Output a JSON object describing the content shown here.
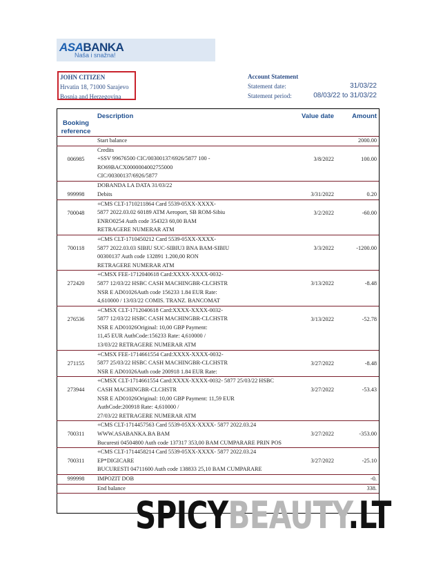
{
  "bank": {
    "logo_asa": "ASA",
    "logo_banka": "BANKA",
    "tagline": "Naša i snažna!"
  },
  "client": {
    "name": "JOHN CITIZEN",
    "address": "Hrvatin 18, 71000 Sarajevo",
    "country": "Bosnia and Herzegovina"
  },
  "statement": {
    "title": "Account Statement",
    "date_label": "Statement date:",
    "date_value": "31/03/22",
    "period_label": "Statement period:",
    "period_value": "08/03/22 to 31/03/22"
  },
  "table": {
    "headers": {
      "ref": "Booking reference",
      "desc": "Description",
      "date": "Value date",
      "amount": "Amount"
    },
    "rows": [
      {
        "ref": "",
        "lines": [
          "Start balance"
        ],
        "date": "",
        "amount": "2000.00"
      },
      {
        "ref": "006985",
        "lines": [
          "Credits",
          "+SSV 99676500 CIC/00300137/6926/5877 100 -",
          "RO69BACX0000004002755000",
          "CIC/00300137/6926/5877"
        ],
        "date": "3/8/2022",
        "amount": "100.00"
      },
      {
        "ref": "999998",
        "lines": [
          "DOBANDA LA DATA 31/03/22",
          "Debits"
        ],
        "date": "3/31/2022",
        "amount": "0.20"
      },
      {
        "ref": "700048",
        "lines": [
          "+CMS CLT-1710211864 Card 5539-05XX-XXXX-",
          "5877 2022.03.02 60189 ATM Aeroport, SB ROM-Sibiu",
          "ENRO0254   Auth code 354323 60,00 BAM",
          "RETRAGERE NUMERAR ATM"
        ],
        "date": "3/2/2022",
        "amount": "-60.00"
      },
      {
        "ref": "700118",
        "lines": [
          "+CMS CLT-1710450212 Card 5539-05XX-XXXX-",
          "5877 2022.03.03 SIBIU SUC-SIBIU3 BNA BAM-SIBIU",
          "00300137 Auth code 132891 1.200,00 RON",
          "RETRAGERE NUMERAR ATM"
        ],
        "date": "3/3/2022",
        "amount": "-1200.00"
      },
      {
        "ref": "272420",
        "lines": [
          "+CMSX FEE-1712040618 Card:XXXX-XXXX-0032-",
          "5877 12/03/22 HSBC CASH MACHINGBR-CLCHSTR",
          "NSR E AD01026Auth code 156233 1.84 EUR Rate:",
          "4,610000 / 13/03/22 COMIS. TRANZ. BANCOMAT"
        ],
        "date": "3/13/2022",
        "amount": "-8.48"
      },
      {
        "ref": "276536",
        "lines": [
          "+CMSX CLT-1712040618 Card:XXXX-XXXX-0032-",
          "5877 12/03/22 HSBC CASH MACHINGBR-CLCHSTR",
          "NSR E AD01026Original: 10,00 GBP Payment:",
          "11,45 EUR AuthCode:156233 Rate: 4,610000 /",
          "13/03/22 RETRAGERE NUMERAR ATM"
        ],
        "date": "3/13/2022",
        "amount": "-52.78"
      },
      {
        "ref": "271155",
        "lines": [
          "+CMSX FEE-1714661554 Card:XXXX-XXXX-0032-",
          "5877 25/03/22 HSBC CASH MACHINGBR-CLCHSTR",
          "NSR E AD01026Auth code 200918 1.84 EUR Rate:"
        ],
        "date": "3/27/2022",
        "amount": "-8.48"
      },
      {
        "ref": "273944",
        "lines": [
          "+CMSX CLT-1714661554 Card:XXXX-XXXX-0032- 5877 25/03/22 HSBC",
          "CASH MACHINGBR-CLCHSTR",
          "NSR E AD01026Original: 10,00 GBP Payment: 11,59 EUR",
          "AuthCode:200918 Rate: 4,610000 /",
          "27/03/22 RETRAGERE NUMERAR ATM"
        ],
        "date": "3/27/2022",
        "amount": "-53.43"
      },
      {
        "ref": "700311",
        "lines": [
          "+CMS CLT-1714457563 Card 5539-05XX-XXXX- 5877 2022.03.24",
          "WWW.ASABANKA.BA BAM",
          "Bucuresti 04504800 Auth code 137317 353,00 BAM CUMPARARE PRIN POS"
        ],
        "date": "3/27/2022",
        "amount": "-353.00"
      },
      {
        "ref": "700311",
        "lines": [
          "+CMS CLT-1714458214 Card 5539-05XX-XXXX- 5877 2022.03.24",
          "EP*DIGICARE",
          "BUCURESTI 04711600 Auth code 138833 25,10 BAM CUMPARARE"
        ],
        "date": "3/27/2022",
        "amount": "-25.10"
      },
      {
        "ref": "999998",
        "lines": [
          "IMPOZIT DOB"
        ],
        "date": "",
        "amount": "-0."
      },
      {
        "ref": "",
        "lines": [
          "End balance"
        ],
        "date": "",
        "amount": "338."
      }
    ]
  },
  "watermark": {
    "part1": "SPICY",
    "part2": "BEAUTY",
    "part3": ".LT"
  }
}
